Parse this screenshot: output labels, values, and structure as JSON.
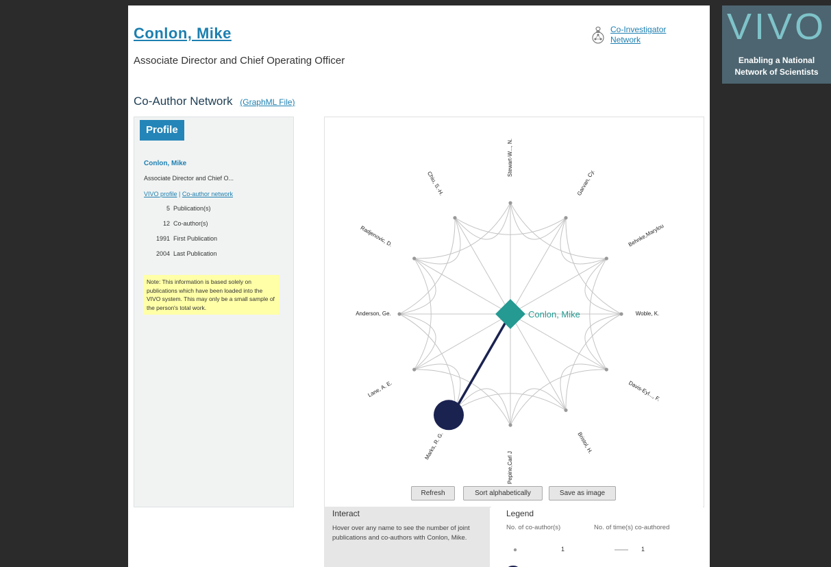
{
  "person": {
    "name": "Conlon, Mike",
    "title": "Associate Director and Chief Operating Officer"
  },
  "co_investigator_link": {
    "line1": "Co-Investigator",
    "line2": "Network"
  },
  "network": {
    "title": "Co-Author Network",
    "graphml_label": "(GraphML File)"
  },
  "profile": {
    "tab_label": "Profile",
    "name": "Conlon, Mike",
    "subtitle": "Associate Director and Chief O...",
    "vivo_profile_link": "VIVO profile",
    "link_separator": "|",
    "coauthor_network_link": "Co-author network",
    "stats": [
      {
        "value": "5",
        "label": "Publication(s)"
      },
      {
        "value": "12",
        "label": "Co-author(s)"
      },
      {
        "value": "1991",
        "label": "First Publication"
      },
      {
        "value": "2004",
        "label": "Last Publication"
      }
    ],
    "note": "Note: This information is based solely on publications which have been loaded into the VIVO system. This may only be a small sample of the person's total work."
  },
  "graph": {
    "center_label": "Conlon, Mike",
    "center_color": "#249a92",
    "highlight_color": "#1a2250",
    "edge_color": "#c4c4c4",
    "coauthors": [
      {
        "name": "Stewart-W..., N."
      },
      {
        "name": "Garvan, Cy."
      },
      {
        "name": "Behnke,Marylou"
      },
      {
        "name": "Woble, K."
      },
      {
        "name": "Davis-Eyl..., F."
      },
      {
        "name": "Bristol, H."
      },
      {
        "name": "Pepine,Carl J"
      },
      {
        "name": "Marks, R. G."
      },
      {
        "name": "Lane, A. E."
      },
      {
        "name": "Anderson, Ge."
      },
      {
        "name": "Radjenovic, D."
      },
      {
        "name": "Chiu, S.-H."
      }
    ]
  },
  "buttons": {
    "refresh": "Refresh",
    "sort": "Sort alphabetically",
    "save": "Save as image"
  },
  "interact": {
    "title": "Interact",
    "text": "Hover over any name to see the number of joint publications and co-authors with Conlon, Mike."
  },
  "legend": {
    "title": "Legend",
    "col1": "No. of co-author(s)",
    "col2": "No. of time(s) co-authored",
    "val1": "1",
    "val2": "1"
  },
  "logo": {
    "word": "VIVO",
    "tagline_1": "Enabling a National",
    "tagline_2": "Network of Scientists"
  }
}
